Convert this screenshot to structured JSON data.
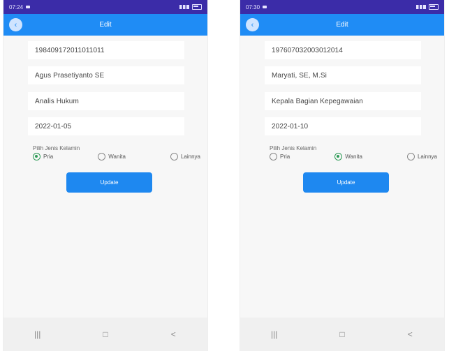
{
  "screens": [
    {
      "status": {
        "time": "07:24",
        "right": "■ ✦ ⅃ ⁞ ⅃ ■"
      },
      "app_title": "Edit",
      "fields": [
        "198409172011011011",
        "Agus Prasetiyanto SE",
        "Analis Hukum",
        "2022-01-05"
      ],
      "jenis_label": "Pilih Jenis Kelamin",
      "radio_options": [
        "Pria",
        "Wanita",
        "Lainnya"
      ],
      "checked_index": 0,
      "button_label": "Update",
      "nav": {
        "recents": "|||",
        "home": "□",
        "back": "<"
      }
    },
    {
      "status": {
        "time": "07:30",
        "right": "■ ✦ ⅃ ⁞ ■"
      },
      "app_title": "Edit",
      "fields": [
        "197607032003012014",
        "Maryati, SE, M.Si",
        "Kepala Bagian Kepegawaian",
        "2022-01-10"
      ],
      "jenis_label": "Pilih Jenis Kelamin",
      "radio_options": [
        "Pria",
        "Wanita",
        "Lainnya"
      ],
      "checked_index": 1,
      "button_label": "Update",
      "nav": {
        "recents": "|||",
        "home": "□",
        "back": "<"
      }
    }
  ]
}
